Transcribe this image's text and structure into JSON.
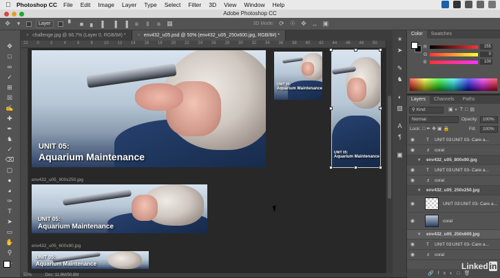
{
  "menubar": {
    "app_name": "Photoshop CC",
    "items": [
      "File",
      "Edit",
      "Image",
      "Layer",
      "Type",
      "Select",
      "Filter",
      "3D",
      "View",
      "Window",
      "Help"
    ]
  },
  "window_title": "Adobe Photoshop CC",
  "options_bar": {
    "auto_select_value": "Layer",
    "mode_3d_label": "3D Mode:"
  },
  "tabs": [
    {
      "label": "challenge.jpg @ 66.7% (Layer 0, RGB/8#) *",
      "active": false
    },
    {
      "label": "env432_u05.psd @ 50% (env432_u05_250x600.jpg, RGB/8#) *",
      "active": true
    }
  ],
  "ruler_ticks": [
    "22",
    "0",
    "2",
    "4",
    "6",
    "8",
    "10",
    "12",
    "14",
    "16",
    "18",
    "20",
    "22",
    "24",
    "26",
    "28",
    "30",
    "32",
    "34",
    "36",
    "38",
    "40",
    "42",
    "44",
    "46",
    "48",
    "50"
  ],
  "canvas": {
    "caption_line1": "UNIT 05:",
    "caption_line2": "Aquarium Maintenance",
    "label_900x250": "env432_u05_900x250.jpg",
    "label_600x90": "env432_u05_600x90.jpg"
  },
  "status": {
    "zoom": "50%",
    "doc": "Doc: 11.6M/50.8M"
  },
  "color_panel": {
    "tabs": [
      "Color",
      "Swatches"
    ],
    "sliders": [
      {
        "label": "R",
        "value": "255",
        "color": "#ff3b3b"
      },
      {
        "label": "G",
        "value": "0",
        "color": "#888888"
      },
      {
        "label": "B",
        "value": "100",
        "color": "#cc4477"
      }
    ]
  },
  "layers_panel": {
    "tabs": [
      "Layers",
      "Channels",
      "Paths"
    ],
    "filter_kind": "Kind",
    "blend_mode": "Normal",
    "opacity_label": "Opacity:",
    "opacity_value": "100%",
    "lock_label": "Lock:",
    "fill_label": "Fill:",
    "fill_value": "100%",
    "rows": [
      {
        "name": "UNIT 03:UNIT 03- Care a...",
        "type": "text",
        "group": false
      },
      {
        "name": "coral",
        "type": "smart",
        "group": false
      },
      {
        "name": "env432_u05_800x90.jpg",
        "type": "group",
        "group": true
      },
      {
        "name": "UNIT 03:UNIT 03- Care a...",
        "type": "text",
        "group": false
      },
      {
        "name": "coral",
        "type": "smart",
        "group": false
      },
      {
        "name": "env432_u05_250x250.jpg",
        "type": "group",
        "group": true
      },
      {
        "name": "UNIT 03:UNIT 03- Care a...",
        "type": "image",
        "group": false
      },
      {
        "name": "coral",
        "type": "image",
        "group": false
      },
      {
        "name": "env432_u05_250x600.jpg",
        "type": "group",
        "group": true
      },
      {
        "name": "UNIT 03:UNIT 03- Care a...",
        "type": "text",
        "group": false
      },
      {
        "name": "coral",
        "type": "smart",
        "group": false
      }
    ]
  },
  "watermark": {
    "text": "Linked",
    "badge": "in"
  }
}
